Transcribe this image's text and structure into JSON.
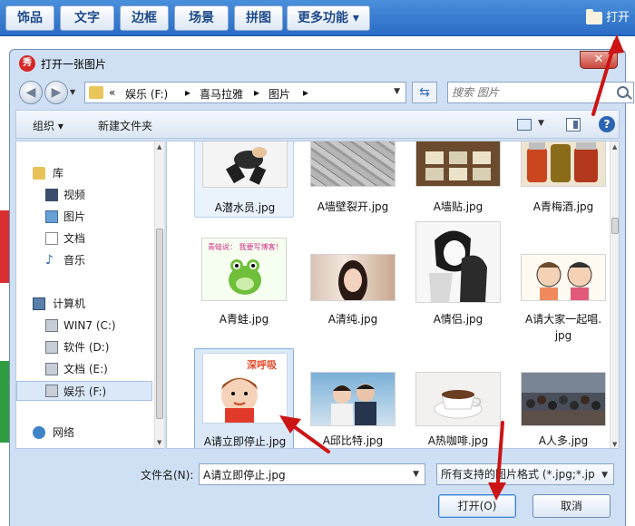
{
  "app_toolbar": {
    "tabs": [
      "饰品",
      "文字",
      "边框",
      "场景",
      "拼图",
      "更多功能 ▾"
    ],
    "open_label": "打开"
  },
  "dialog": {
    "title": "打开一张图片",
    "close_label": "✕",
    "address": {
      "chevron": "«",
      "segments": [
        "娱乐 (F:)",
        "喜马拉雅",
        "图片"
      ],
      "separator": "▸"
    },
    "search_placeholder": "搜索 图片",
    "commands": {
      "organize": "组织 ▾",
      "new_folder": "新建文件夹"
    },
    "nav": {
      "libraries_label": "库",
      "libraries": [
        "视频",
        "图片",
        "文档",
        "音乐"
      ],
      "computer_label": "计算机",
      "drives": [
        "WIN7 (C:)",
        "软件 (D:)",
        "文档 (E:)",
        "娱乐 (F:)"
      ],
      "network_label": "网络"
    },
    "files": [
      {
        "name": "A潜水员.jpg"
      },
      {
        "name": "A墙壁裂开.jpg"
      },
      {
        "name": "A墙贴.jpg"
      },
      {
        "name": "A青梅酒.jpg"
      },
      {
        "name": "A青蛙.jpg"
      },
      {
        "name": "A清纯.jpg"
      },
      {
        "name": "A情侣.jpg"
      },
      {
        "name": "A请大家一起唱.jpg",
        "line1": "A请大家一起唱.",
        "line2": "jpg"
      },
      {
        "name": "A请立即停止.jpg",
        "caption": "深呼吸"
      },
      {
        "name": "A邱比特.jpg"
      },
      {
        "name": "A热咖啡.jpg"
      },
      {
        "name": "A人多.jpg"
      }
    ],
    "frog_caption": "青蛙说：  我要写博客！",
    "filename_label": "文件名(N):",
    "filename_value": "A请立即停止.jpg",
    "filter_value": "所有支持的图片格式 (*.jpg;*.jp",
    "open_button": "打开(O)",
    "cancel_button": "取消"
  },
  "colors": {
    "toolbar_blue": "#2a6cc4",
    "annotation_red": "#cc1414",
    "selection_blue": "#dbe8f8"
  }
}
